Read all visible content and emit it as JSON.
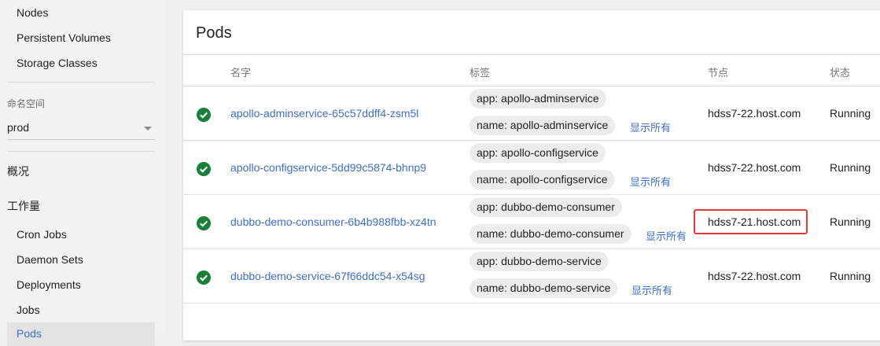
{
  "sidebar": {
    "cluster_items": [
      "Nodes",
      "Persistent Volumes",
      "Storage Classes"
    ],
    "namespace_label": "命名空间",
    "namespace_value": "prod",
    "overview_label": "概况",
    "workloads_label": "工作量",
    "workload_items": [
      "Cron Jobs",
      "Daemon Sets",
      "Deployments",
      "Jobs",
      "Pods"
    ],
    "active_item": "Pods"
  },
  "card": {
    "title": "Pods",
    "columns": {
      "name": "名字",
      "labels": "标签",
      "node": "节点",
      "status": "状态"
    },
    "show_all_label": "显示所有",
    "rows": [
      {
        "name": "apollo-adminservice-65c57ddff4-zsm5l",
        "labels": [
          "app: apollo-adminservice",
          "name: apollo-adminservice"
        ],
        "node": "hdss7-22.host.com",
        "status": "Running"
      },
      {
        "name": "apollo-configservice-5dd99c5874-bhnp9",
        "labels": [
          "app: apollo-configservice",
          "name: apollo-configservice"
        ],
        "node": "hdss7-22.host.com",
        "status": "Running"
      },
      {
        "name": "dubbo-demo-consumer-6b4b988fbb-xz4tn",
        "labels": [
          "app: dubbo-demo-consumer",
          "name: dubbo-demo-consumer"
        ],
        "node": "hdss7-21.host.com",
        "status": "Running"
      },
      {
        "name": "dubbo-demo-service-67f66ddc54-x54sg",
        "labels": [
          "app: dubbo-demo-service",
          "name: dubbo-demo-service"
        ],
        "node": "hdss7-22.host.com",
        "status": "Running"
      }
    ]
  },
  "colors": {
    "accent": "#3f6ed3",
    "success": "#188038",
    "highlight": "#e53935"
  },
  "icons": {
    "status": "check-circle-icon",
    "dropdown": "chevron-down-icon"
  }
}
